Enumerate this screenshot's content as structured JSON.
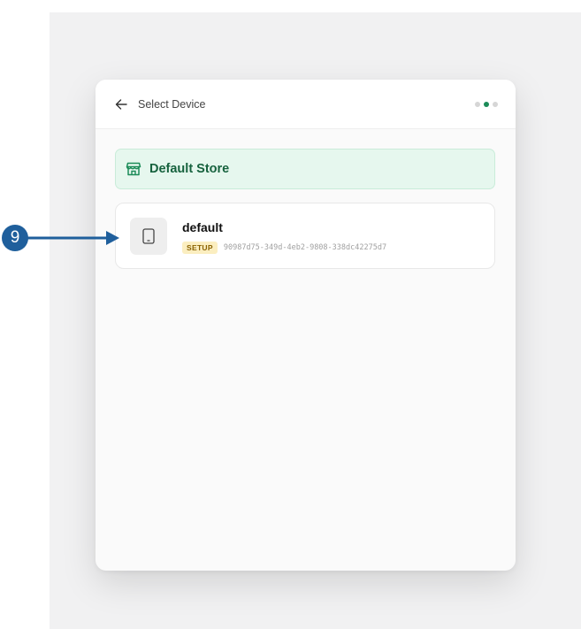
{
  "header": {
    "title": "Select Device",
    "back_icon": "arrow-left-icon",
    "steps_total": 3,
    "steps_active": 2
  },
  "store": {
    "name": "Default Store",
    "icon": "storefront-icon"
  },
  "devices": [
    {
      "name": "default",
      "status": "SETUP",
      "id": "90987d75-349d-4eb2-9808-338dc42275d7",
      "icon": "tablet-icon"
    }
  ],
  "annotation": {
    "callout_number": "9"
  },
  "colors": {
    "accent_green": "#1b8b58",
    "store_bg": "#e6f7ee",
    "badge_bg": "#fbeec0",
    "callout_blue": "#1f5f9c"
  }
}
